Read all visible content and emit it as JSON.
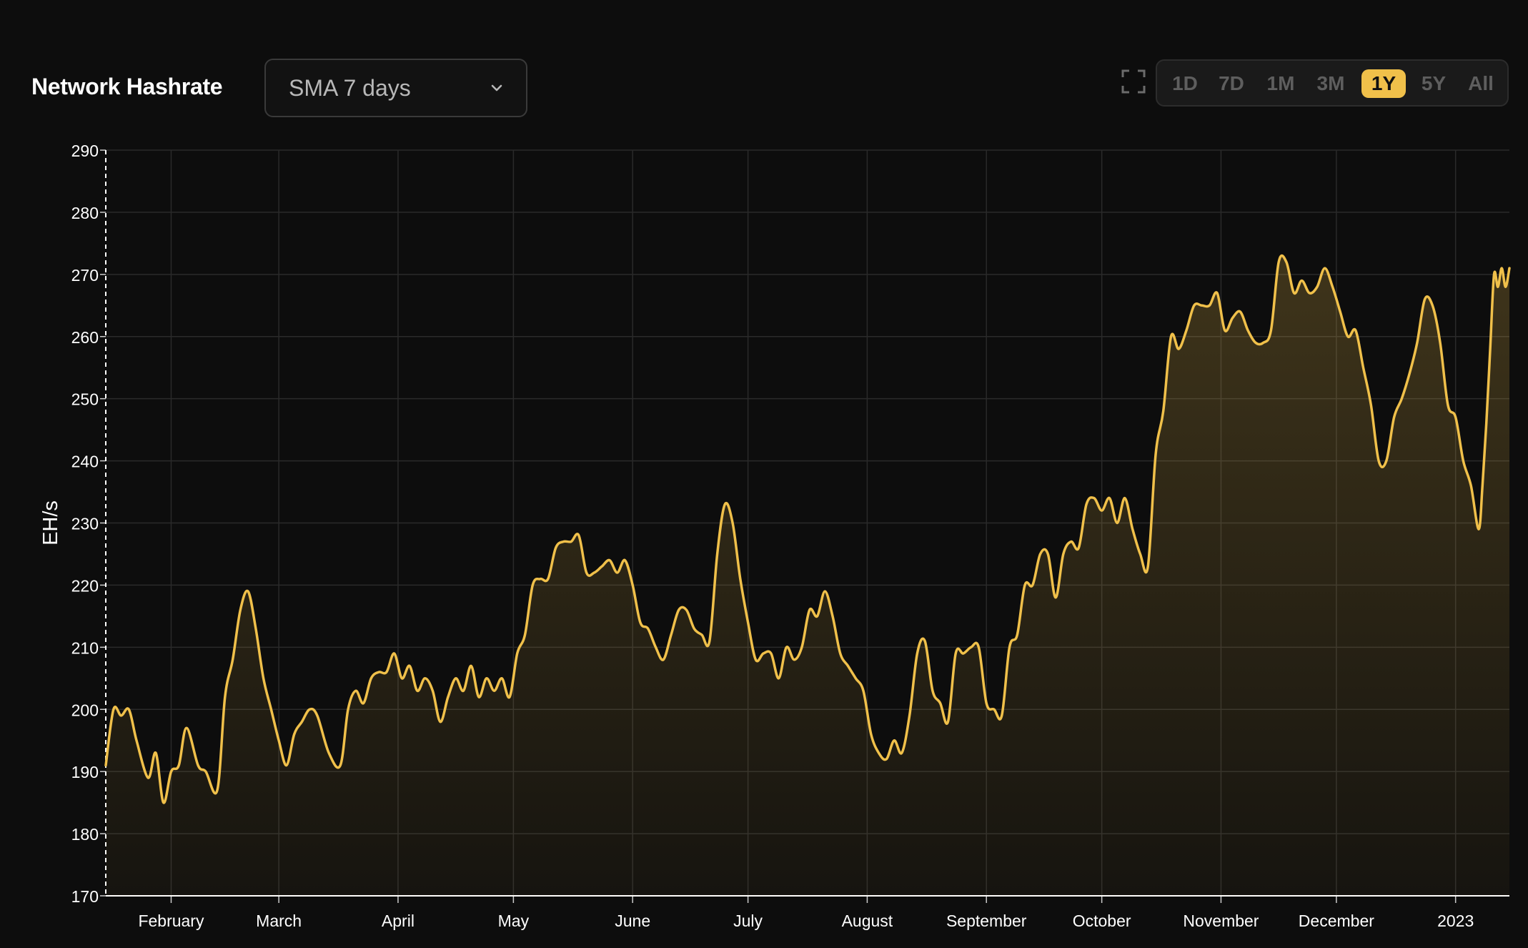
{
  "header": {
    "title": "Network Hashrate",
    "select_value": "SMA 7 days"
  },
  "toolbar": {
    "ranges": [
      "1D",
      "7D",
      "1M",
      "3M",
      "1Y",
      "5Y",
      "All"
    ],
    "active_range": "1Y",
    "icons": {
      "expand": "expand-icon",
      "dropdown": "chevron-down-icon"
    }
  },
  "colors": {
    "background": "#0d0d0d",
    "line": "#f0c04a",
    "active_range_bg": "#f0c04a",
    "grid": "#2a2a2a"
  },
  "chart_data": {
    "type": "area",
    "ylabel": "EH/s",
    "ylim": [
      170,
      290
    ],
    "yticks": [
      170,
      180,
      190,
      200,
      210,
      220,
      230,
      240,
      250,
      260,
      270,
      280,
      290
    ],
    "xlim": [
      "2022-01-15",
      "2023-01-15"
    ],
    "xticks": [
      {
        "label": "February",
        "date": "2022-02-01"
      },
      {
        "label": "March",
        "date": "2022-03-01"
      },
      {
        "label": "April",
        "date": "2022-04-01"
      },
      {
        "label": "May",
        "date": "2022-05-01"
      },
      {
        "label": "June",
        "date": "2022-06-01"
      },
      {
        "label": "July",
        "date": "2022-07-01"
      },
      {
        "label": "August",
        "date": "2022-08-01"
      },
      {
        "label": "September",
        "date": "2022-09-01"
      },
      {
        "label": "October",
        "date": "2022-10-01"
      },
      {
        "label": "November",
        "date": "2022-11-01"
      },
      {
        "label": "December",
        "date": "2022-12-01"
      },
      {
        "label": "2023",
        "date": "2023-01-01"
      }
    ],
    "grid": true,
    "series": [
      {
        "values": [
          [
            "2022-01-15",
            191
          ],
          [
            "2022-01-17",
            200
          ],
          [
            "2022-01-19",
            199
          ],
          [
            "2022-01-21",
            200
          ],
          [
            "2022-01-23",
            195
          ],
          [
            "2022-01-26",
            189
          ],
          [
            "2022-01-28",
            193
          ],
          [
            "2022-01-30",
            185
          ],
          [
            "2022-02-01",
            190
          ],
          [
            "2022-02-03",
            191
          ],
          [
            "2022-02-05",
            197
          ],
          [
            "2022-02-08",
            191
          ],
          [
            "2022-02-10",
            190
          ],
          [
            "2022-02-13",
            187
          ],
          [
            "2022-02-15",
            202
          ],
          [
            "2022-02-17",
            208
          ],
          [
            "2022-02-19",
            216
          ],
          [
            "2022-02-21",
            219
          ],
          [
            "2022-02-23",
            213
          ],
          [
            "2022-02-25",
            205
          ],
          [
            "2022-02-27",
            200
          ],
          [
            "2022-03-01",
            195
          ],
          [
            "2022-03-03",
            191
          ],
          [
            "2022-03-05",
            196
          ],
          [
            "2022-03-07",
            198
          ],
          [
            "2022-03-09",
            200
          ],
          [
            "2022-03-11",
            199
          ],
          [
            "2022-03-14",
            193
          ],
          [
            "2022-03-17",
            191
          ],
          [
            "2022-03-19",
            200
          ],
          [
            "2022-03-21",
            203
          ],
          [
            "2022-03-23",
            201
          ],
          [
            "2022-03-25",
            205
          ],
          [
            "2022-03-27",
            206
          ],
          [
            "2022-03-29",
            206
          ],
          [
            "2022-03-31",
            209
          ],
          [
            "2022-04-02",
            205
          ],
          [
            "2022-04-04",
            207
          ],
          [
            "2022-04-06",
            203
          ],
          [
            "2022-04-08",
            205
          ],
          [
            "2022-04-10",
            203
          ],
          [
            "2022-04-12",
            198
          ],
          [
            "2022-04-14",
            202
          ],
          [
            "2022-04-16",
            205
          ],
          [
            "2022-04-18",
            203
          ],
          [
            "2022-04-20",
            207
          ],
          [
            "2022-04-22",
            202
          ],
          [
            "2022-04-24",
            205
          ],
          [
            "2022-04-26",
            203
          ],
          [
            "2022-04-28",
            205
          ],
          [
            "2022-04-30",
            202
          ],
          [
            "2022-05-02",
            209
          ],
          [
            "2022-05-04",
            212
          ],
          [
            "2022-05-06",
            220
          ],
          [
            "2022-05-08",
            221
          ],
          [
            "2022-05-10",
            221
          ],
          [
            "2022-05-12",
            226
          ],
          [
            "2022-05-14",
            227
          ],
          [
            "2022-05-16",
            227
          ],
          [
            "2022-05-18",
            228
          ],
          [
            "2022-05-20",
            222
          ],
          [
            "2022-05-22",
            222
          ],
          [
            "2022-05-24",
            223
          ],
          [
            "2022-05-26",
            224
          ],
          [
            "2022-05-28",
            222
          ],
          [
            "2022-05-30",
            224
          ],
          [
            "2022-06-01",
            220
          ],
          [
            "2022-06-03",
            214
          ],
          [
            "2022-06-05",
            213
          ],
          [
            "2022-06-07",
            210
          ],
          [
            "2022-06-09",
            208
          ],
          [
            "2022-06-11",
            212
          ],
          [
            "2022-06-13",
            216
          ],
          [
            "2022-06-15",
            216
          ],
          [
            "2022-06-17",
            213
          ],
          [
            "2022-06-19",
            212
          ],
          [
            "2022-06-21",
            211
          ],
          [
            "2022-06-23",
            225
          ],
          [
            "2022-06-25",
            233
          ],
          [
            "2022-06-27",
            230
          ],
          [
            "2022-06-29",
            221
          ],
          [
            "2022-07-01",
            214
          ],
          [
            "2022-07-03",
            208
          ],
          [
            "2022-07-05",
            209
          ],
          [
            "2022-07-07",
            209
          ],
          [
            "2022-07-09",
            205
          ],
          [
            "2022-07-11",
            210
          ],
          [
            "2022-07-13",
            208
          ],
          [
            "2022-07-15",
            210
          ],
          [
            "2022-07-17",
            216
          ],
          [
            "2022-07-19",
            215
          ],
          [
            "2022-07-21",
            219
          ],
          [
            "2022-07-23",
            215
          ],
          [
            "2022-07-25",
            209
          ],
          [
            "2022-07-27",
            207
          ],
          [
            "2022-07-29",
            205
          ],
          [
            "2022-07-31",
            203
          ],
          [
            "2022-08-02",
            196
          ],
          [
            "2022-08-04",
            193
          ],
          [
            "2022-08-06",
            192
          ],
          [
            "2022-08-08",
            195
          ],
          [
            "2022-08-10",
            193
          ],
          [
            "2022-08-12",
            199
          ],
          [
            "2022-08-14",
            209
          ],
          [
            "2022-08-16",
            211
          ],
          [
            "2022-08-18",
            203
          ],
          [
            "2022-08-20",
            201
          ],
          [
            "2022-08-22",
            198
          ],
          [
            "2022-08-24",
            209
          ],
          [
            "2022-08-26",
            209
          ],
          [
            "2022-08-28",
            210
          ],
          [
            "2022-08-30",
            210
          ],
          [
            "2022-09-01",
            201
          ],
          [
            "2022-09-03",
            200
          ],
          [
            "2022-09-05",
            199
          ],
          [
            "2022-09-07",
            210
          ],
          [
            "2022-09-09",
            212
          ],
          [
            "2022-09-11",
            220
          ],
          [
            "2022-09-13",
            220
          ],
          [
            "2022-09-15",
            225
          ],
          [
            "2022-09-17",
            225
          ],
          [
            "2022-09-19",
            218
          ],
          [
            "2022-09-21",
            225
          ],
          [
            "2022-09-23",
            227
          ],
          [
            "2022-09-25",
            226
          ],
          [
            "2022-09-27",
            233
          ],
          [
            "2022-09-29",
            234
          ],
          [
            "2022-10-01",
            232
          ],
          [
            "2022-10-03",
            234
          ],
          [
            "2022-10-05",
            230
          ],
          [
            "2022-10-07",
            234
          ],
          [
            "2022-10-09",
            229
          ],
          [
            "2022-10-11",
            225
          ],
          [
            "2022-10-13",
            223
          ],
          [
            "2022-10-15",
            241
          ],
          [
            "2022-10-17",
            248
          ],
          [
            "2022-10-19",
            260
          ],
          [
            "2022-10-21",
            258
          ],
          [
            "2022-10-23",
            261
          ],
          [
            "2022-10-25",
            265
          ],
          [
            "2022-10-27",
            265
          ],
          [
            "2022-10-29",
            265
          ],
          [
            "2022-10-31",
            267
          ],
          [
            "2022-11-02",
            261
          ],
          [
            "2022-11-04",
            263
          ],
          [
            "2022-11-06",
            264
          ],
          [
            "2022-11-08",
            261
          ],
          [
            "2022-11-10",
            259
          ],
          [
            "2022-11-12",
            259
          ],
          [
            "2022-11-14",
            261
          ],
          [
            "2022-11-16",
            272
          ],
          [
            "2022-11-18",
            272
          ],
          [
            "2022-11-20",
            267
          ],
          [
            "2022-11-22",
            269
          ],
          [
            "2022-11-24",
            267
          ],
          [
            "2022-11-26",
            268
          ],
          [
            "2022-11-28",
            271
          ],
          [
            "2022-11-30",
            268
          ],
          [
            "2022-12-02",
            264
          ],
          [
            "2022-12-04",
            260
          ],
          [
            "2022-12-06",
            261
          ],
          [
            "2022-12-08",
            255
          ],
          [
            "2022-12-10",
            249
          ],
          [
            "2022-12-12",
            240
          ],
          [
            "2022-12-14",
            240
          ],
          [
            "2022-12-16",
            247
          ],
          [
            "2022-12-18",
            250
          ],
          [
            "2022-12-20",
            254
          ],
          [
            "2022-12-22",
            259
          ],
          [
            "2022-12-24",
            266
          ],
          [
            "2022-12-26",
            265
          ],
          [
            "2022-12-28",
            259
          ],
          [
            "2022-12-30",
            249
          ],
          [
            "2023-01-01",
            247
          ],
          [
            "2023-01-03",
            240
          ],
          [
            "2023-01-05",
            236
          ],
          [
            "2023-01-07",
            229
          ],
          [
            "2023-01-08",
            236
          ],
          [
            "2023-01-09",
            246
          ],
          [
            "2023-01-10",
            258
          ],
          [
            "2023-01-11",
            270
          ],
          [
            "2023-01-12",
            268
          ],
          [
            "2023-01-13",
            271
          ],
          [
            "2023-01-14",
            268
          ],
          [
            "2023-01-15",
            271
          ]
        ]
      }
    ]
  }
}
